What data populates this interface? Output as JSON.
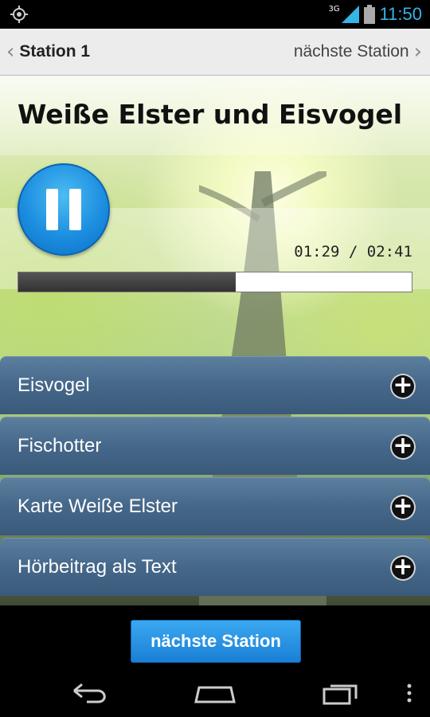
{
  "status_bar": {
    "network": "3G",
    "time": "11:50",
    "time_color": "#33b5e5"
  },
  "nav": {
    "back_label": "Station 1",
    "next_label": "nächste Station"
  },
  "page": {
    "title": "Weiße Elster und Eisvogel"
  },
  "player": {
    "state_icon": "pause-icon",
    "time_display": "01:29 / 02:41",
    "progress_fraction": 0.553
  },
  "list": {
    "items": [
      {
        "label": "Eisvogel"
      },
      {
        "label": "Fischotter"
      },
      {
        "label": "Karte Weiße Elster"
      },
      {
        "label": "Hörbeitrag als Text"
      }
    ]
  },
  "footer": {
    "next_button_label": "nächste Station"
  },
  "colors": {
    "accent_blue": "#1a7fd6",
    "list_bg": "#45678a"
  }
}
